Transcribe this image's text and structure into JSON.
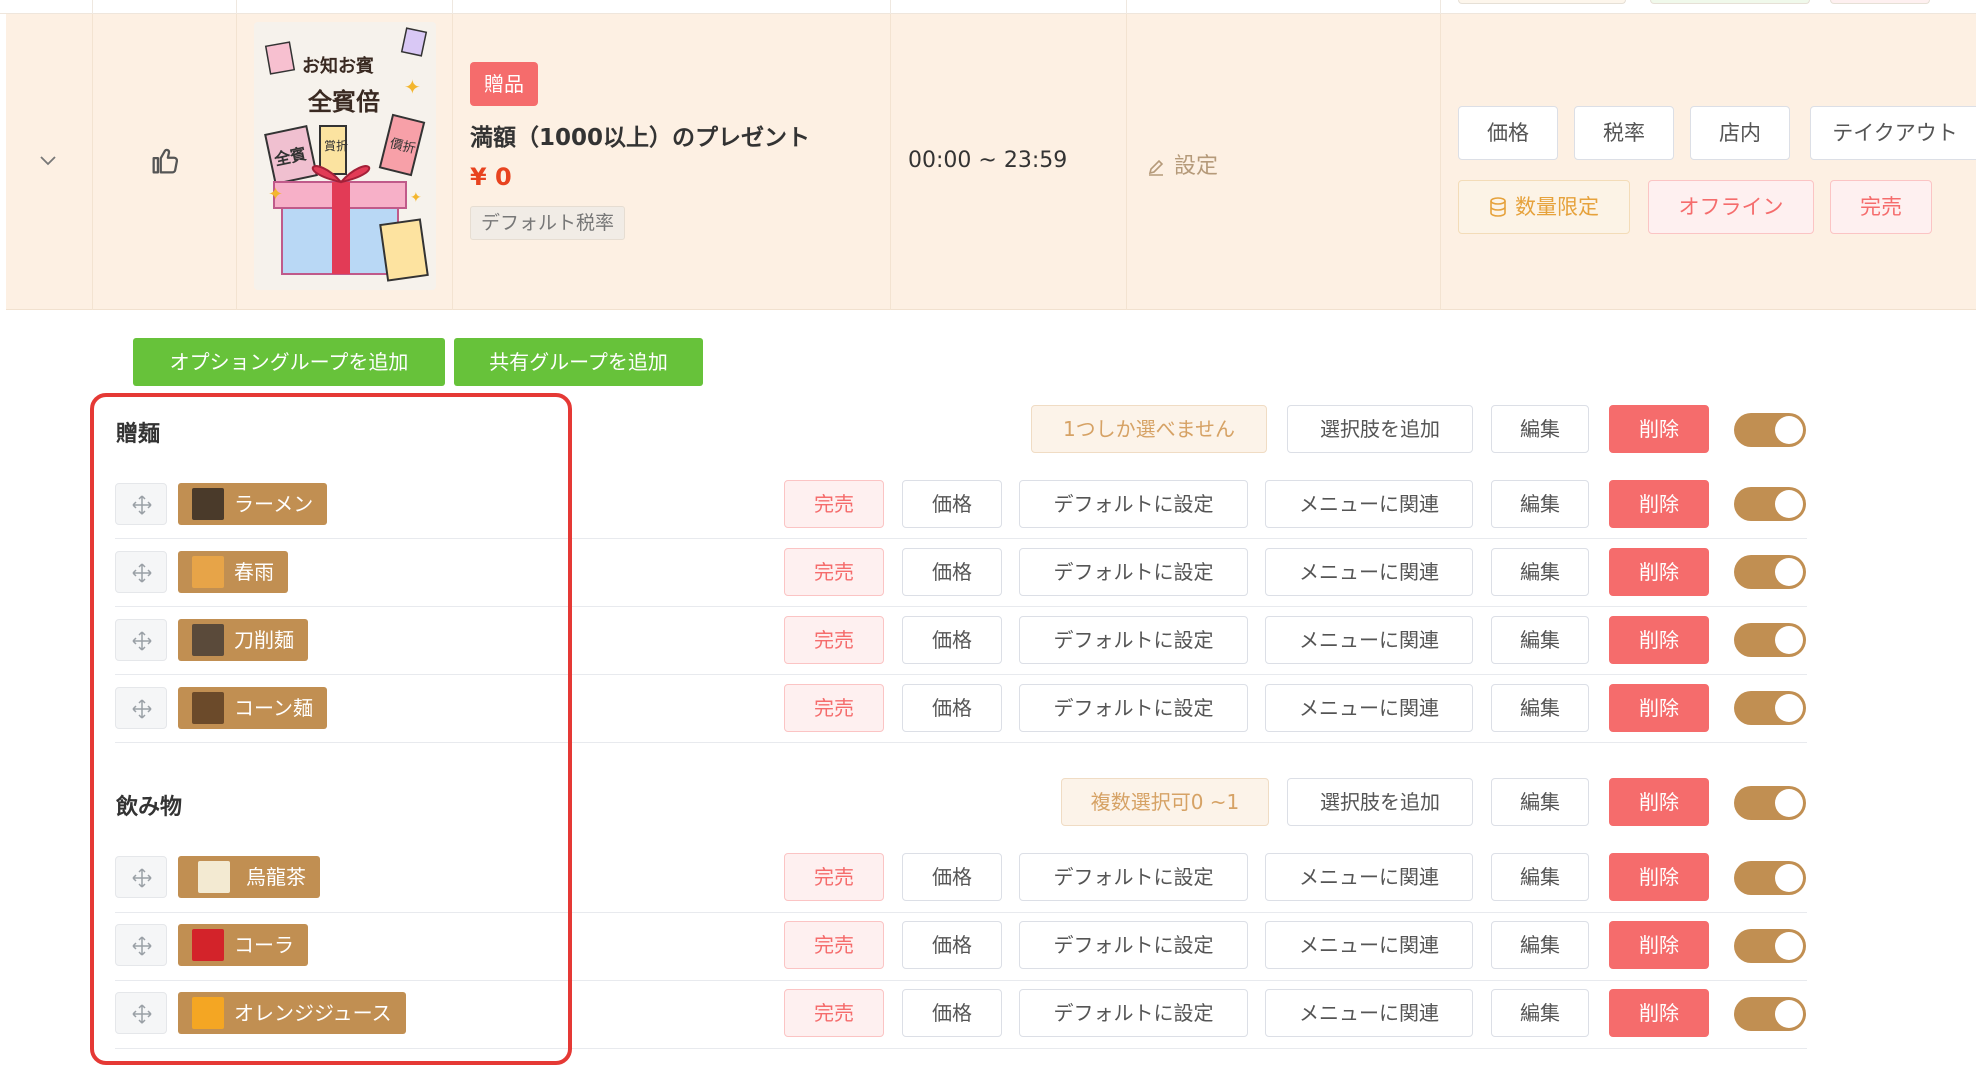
{
  "product": {
    "tag": "贈品",
    "title": "満額（1000以上）のプレゼント",
    "price": "¥ 0",
    "tax_tag": "デフォルト税率",
    "time": "00:00 ~ 23:59",
    "setting_label": "設定",
    "image_text": [
      "お知お賓",
      "全賓倍",
      "全賓",
      "賞折",
      "價折"
    ],
    "actions_row1": [
      "価格",
      "税率",
      "店内",
      "テイクアウト"
    ],
    "actions_row2": {
      "limit": "数量限定",
      "offline": "オフライン",
      "soldout": "完売"
    }
  },
  "toolbar": {
    "add_option_group": "オプショングループを追加",
    "add_shared_group": "共有グループを追加"
  },
  "groups": [
    {
      "name": "贈麺",
      "rule": "1つしか選べません",
      "add_option": "選択肢を追加",
      "edit": "編集",
      "delete": "削除",
      "items": [
        {
          "name": "ラーメン"
        },
        {
          "name": "春雨"
        },
        {
          "name": "刀削麺"
        },
        {
          "name": "コーン麺"
        }
      ]
    },
    {
      "name": "飲み物",
      "rule": "複数選択可0 ~1",
      "add_option": "選択肢を追加",
      "edit": "編集",
      "delete": "削除",
      "items": [
        {
          "name": "烏龍茶"
        },
        {
          "name": "コーラ"
        },
        {
          "name": "オレンジジュース"
        }
      ]
    }
  ],
  "item_actions": {
    "soldout": "完売",
    "price": "価格",
    "set_default": "デフォルトに設定",
    "link_menu": "メニューに関連",
    "edit": "編集",
    "delete": "削除"
  },
  "colors": {
    "row_highlight": "#fdf0e3",
    "green": "#67c23a",
    "danger": "#f56c6c",
    "chip_brown": "#c18f52",
    "frame_red": "#e53935"
  }
}
